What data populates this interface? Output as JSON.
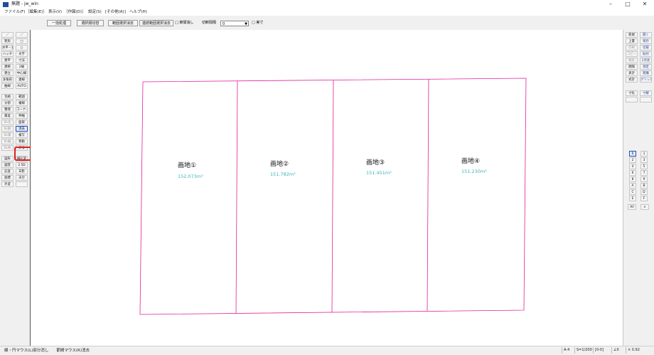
{
  "window": {
    "title": "無題 - jw_win",
    "minimize_glyph": "–",
    "maximize_glyph": "□",
    "close_glyph": "✕"
  },
  "menu": [
    "ファイル(F)",
    "［編集(E)］",
    "表示(V)",
    "［作図(D)］",
    "設定(S)",
    "[その他(A)]",
    "ヘルプ(H)"
  ],
  "toolbar": {
    "buttons": [
      "一括処理",
      "選択順切替",
      "範囲選択消去",
      "連続範囲選択消去"
    ],
    "check_section": "□ 節間消し",
    "interval_label": "切断間隔",
    "interval_value": "0",
    "check_real": "□ 実寸"
  },
  "left_tools": [
    [
      "／",
      "／"
    ],
    [
      "矩形",
      "□"
    ],
    [
      "水平・垂直",
      "○"
    ],
    [
      "ハッチ",
      "文字"
    ],
    [
      "建平",
      "寸法"
    ],
    [
      "建断",
      "2線"
    ],
    [
      "建立",
      "中心線"
    ],
    [
      "多角形",
      "連線"
    ],
    [
      "曲線",
      "AUTO"
    ],
    [
      "包絡",
      "範囲"
    ],
    [
      "分割",
      "複線"
    ],
    [
      "整理",
      "コーナー"
    ],
    [
      "属変",
      "伸縮"
    ],
    [
      "BL化",
      "面取"
    ],
    [
      "BL解",
      "消去"
    ],
    [
      "BL属",
      "複写"
    ],
    [
      "BL編",
      "移動"
    ],
    [
      "BL終",
      "戻る"
    ],
    [
      "図形",
      "線記変"
    ],
    [
      "図登",
      "2.5D"
    ],
    [
      "記変",
      "日影"
    ],
    [
      "座標",
      "天空"
    ],
    [
      "外変",
      ""
    ]
  ],
  "right_tools": [
    [
      "新規",
      "開く"
    ],
    [
      "上書",
      "保存"
    ],
    [
      "印刷",
      "切取"
    ],
    [
      "コピー",
      "貼付"
    ],
    [
      "線長",
      "2点長"
    ],
    [
      "間隔",
      "測定"
    ],
    [
      "表計",
      "距離"
    ],
    [
      "式計",
      "グリッド"
    ],
    [
      "寸化",
      "寸解"
    ],
    [
      "",
      ""
    ]
  ],
  "right_layers": [
    "0",
    "1",
    "2",
    "3",
    "4",
    "5",
    "6",
    "7",
    "8",
    "9",
    "A",
    "B",
    "C",
    "D",
    "E",
    "F"
  ],
  "right_bottom": [
    "All",
    "×"
  ],
  "lots": [
    {
      "label": "画地①",
      "area": "152.073m²"
    },
    {
      "label": "画地②",
      "area": "151.782m²"
    },
    {
      "label": "画地③",
      "area": "151.451m²"
    },
    {
      "label": "画地④",
      "area": "151.230m²"
    }
  ],
  "status": {
    "hint": "線・円マウス(L)部分消し　　節間マウス(R)消去",
    "paper": "A-4",
    "scale": "S=1/200",
    "layer": "[0-0]",
    "angle": "∠0",
    "zoom": "× 0.92"
  },
  "colors": {
    "lot_outline": "#e0209a",
    "area_text": "#3fb3b7",
    "highlight": "#e02020"
  }
}
